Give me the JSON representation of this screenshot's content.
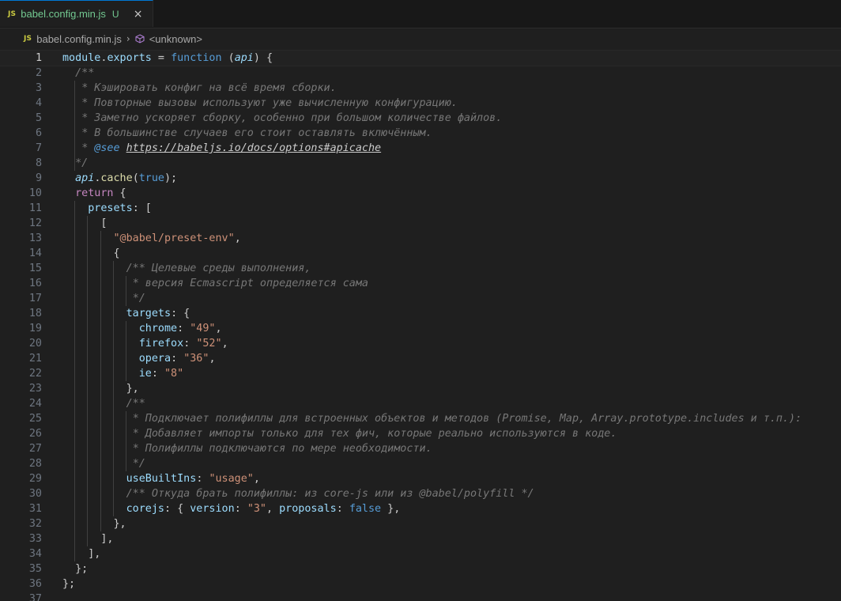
{
  "tab": {
    "badge": "JS",
    "title": "babel.config.min.js",
    "status": "U",
    "close": "×"
  },
  "breadcrumb": {
    "badge": "JS",
    "file": "babel.config.min.js",
    "separator": "›",
    "symbol": "<unknown>"
  },
  "code": {
    "current_line": 1,
    "lines": [
      {
        "n": "1",
        "t": "module.exports = function (api) {"
      },
      {
        "n": "2",
        "t": "  /**"
      },
      {
        "n": "3",
        "t": "   * Кэшировать конфиг на всё время сборки."
      },
      {
        "n": "4",
        "t": "   * Повторные вызовы используют уже вычисленную конфигурацию."
      },
      {
        "n": "5",
        "t": "   * Заметно ускоряет сборку, особенно при большом количестве файлов."
      },
      {
        "n": "6",
        "t": "   * В большинстве случаев его стоит оставлять включённым."
      },
      {
        "n": "7",
        "t": "   * @see https://babeljs.io/docs/options#apicache"
      },
      {
        "n": "8",
        "t": "  */"
      },
      {
        "n": "9",
        "t": "  api.cache(true);"
      },
      {
        "n": "10",
        "t": "  return {"
      },
      {
        "n": "11",
        "t": "    presets: ["
      },
      {
        "n": "12",
        "t": "      ["
      },
      {
        "n": "13",
        "t": "        \"@babel/preset-env\","
      },
      {
        "n": "14",
        "t": "        {"
      },
      {
        "n": "15",
        "t": "          /** Целевые среды выполнения,"
      },
      {
        "n": "16",
        "t": "           * версия Ecmascript определяется сама"
      },
      {
        "n": "17",
        "t": "           */"
      },
      {
        "n": "18",
        "t": "          targets: {"
      },
      {
        "n": "19",
        "t": "            chrome: \"49\","
      },
      {
        "n": "20",
        "t": "            firefox: \"52\","
      },
      {
        "n": "21",
        "t": "            opera: \"36\","
      },
      {
        "n": "22",
        "t": "            ie: \"8\""
      },
      {
        "n": "23",
        "t": "          },"
      },
      {
        "n": "24",
        "t": "          /**"
      },
      {
        "n": "25",
        "t": "           * Подключает полифиллы для встроенных объектов и методов (Promise, Map, Array.prototype.includes и т.п.):"
      },
      {
        "n": "26",
        "t": "           * Добавляет импорты только для тех фич, которые реально используются в коде."
      },
      {
        "n": "27",
        "t": "           * Полифиллы подключаются по мере необходимости."
      },
      {
        "n": "28",
        "t": "           */"
      },
      {
        "n": "29",
        "t": "          useBuiltIns: \"usage\","
      },
      {
        "n": "30",
        "t": "          /** Откуда брать полифиллы: из core-js или из @babel/polyfill */"
      },
      {
        "n": "31",
        "t": "          corejs: { version: \"3\", proposals: false },"
      },
      {
        "n": "32",
        "t": "        },"
      },
      {
        "n": "33",
        "t": "      ],"
      },
      {
        "n": "34",
        "t": "    ],"
      },
      {
        "n": "35",
        "t": "  };"
      },
      {
        "n": "36",
        "t": "};"
      },
      {
        "n": "37",
        "t": ""
      }
    ]
  },
  "colors": {
    "background": "#1f1f1f",
    "keyword": "#569cd6",
    "function": "#dcdcaa",
    "variable": "#9cdcfe",
    "string": "#ce9178",
    "comment": "#777777",
    "bracket_1": "#ffd700",
    "bracket_2": "#da70d6",
    "bracket_3": "#179fff",
    "untracked": "#73c991",
    "accent": "#0078d4"
  }
}
